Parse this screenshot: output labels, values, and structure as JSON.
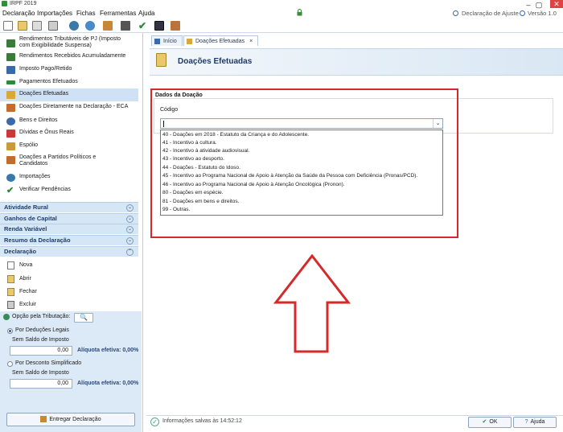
{
  "window": {
    "title": "IRPF 2019",
    "minimize": "–",
    "maximize": "▢",
    "close": "✕"
  },
  "menu": {
    "items": [
      "Declaração",
      "Importações",
      "Fichas",
      "Ferramentas",
      "Ajuda"
    ],
    "help_link": "Declaração de Ajuste",
    "version": "Versão 1.0"
  },
  "sidebar": {
    "items": [
      {
        "label": "Rendimentos Tributáveis de PJ (Imposto\ncom Exigibilidade Suspensa)",
        "icon": "money-icon",
        "color": "#3a7a3a"
      },
      {
        "label": "Rendimentos Recebidos Acumuladamente",
        "icon": "money-icon",
        "color": "#3a7a3a"
      },
      {
        "label": "Imposto Pago/Retido",
        "icon": "receipt-icon",
        "color": "#3a6aa8"
      },
      {
        "label": "Pagamentos Efetuados",
        "icon": "payment-icon",
        "color": "#2d8a3a"
      },
      {
        "label": "Doações Efetuadas",
        "icon": "donation-icon",
        "color": "#d8a93a"
      },
      {
        "label": "Doações Diretamente na Declaração - ECA",
        "icon": "eca-icon",
        "color": "#c86a2a"
      },
      {
        "label": "Bens e Direitos",
        "icon": "house-icon",
        "color": "#3a6aa8"
      },
      {
        "label": "Dívidas e Ônus Reais",
        "icon": "debt-icon",
        "color": "#c83a3a"
      },
      {
        "label": "Espólio",
        "icon": "estate-icon",
        "color": "#c89a3a"
      },
      {
        "label": "Doações a Partidos Políticos e\nCandidatos",
        "icon": "party-icon",
        "color": "#c86a2a"
      },
      {
        "label": "Importações",
        "icon": "import-icon",
        "color": "#3a7aa8"
      },
      {
        "label": "Verificar Pendências",
        "icon": "check-icon",
        "color": "#2d8a3a"
      }
    ],
    "groups": [
      "Atividade Rural",
      "Ganhos de Capital",
      "Renda Variável",
      "Resumo da Declaração",
      "Declaração"
    ],
    "declaracao_items": [
      "Nova",
      "Abrir",
      "Fechar",
      "Excluir"
    ]
  },
  "opcao": {
    "title": "Opção pela Tributação:",
    "search_icon": "🔍",
    "deducoes_label": "Por Deduções Legais",
    "deducoes_sub": "Sem Saldo de Imposto",
    "deducoes_value": "0,00",
    "deducoes_aliquota": "Alíquota efetiva: 0,00%",
    "simplificado_label": "Por Desconto Simplificado",
    "simplificado_sub": "Sem Saldo de Imposto",
    "simplificado_value": "0,00",
    "simplificado_aliquota": "Alíquota efetiva: 0,00%",
    "entregar": "Entregar Declaração"
  },
  "tabs": [
    {
      "label": "Início"
    },
    {
      "label": "Doações Efetuadas",
      "close": "×"
    }
  ],
  "page": {
    "title": "Doações Efetuadas"
  },
  "form": {
    "section": "Dados da Doação",
    "field_label": "Código",
    "value": "",
    "options": [
      "40 - Doações em 2018 - Estatuto da Criança e do Adolescente.",
      "41 - Incentivo à cultura.",
      "42 - Incentivo à atividade audiovisual.",
      "43 - Incentivo ao desporto.",
      "44 - Doações - Estatuto do Idoso.",
      "45 - Incentivo ao Programa Nacional de Apoio à Atenção da Saúde da Pessoa com Deficiência (Pronas/PCD).",
      "46 - Incentivo ao Programa Nacional de Apoio à Atenção Oncológica (Pronon).",
      "80 - Doações em espécie.",
      "81 - Doações em bens e direitos.",
      "99 - Outras."
    ]
  },
  "status": {
    "text": "Informações salvas às 14:52:12"
  },
  "buttons": {
    "ok": "OK",
    "ajuda": "Ajuda"
  },
  "colors": {
    "highlight": "#d42a2a",
    "accent": "#1d3a64"
  }
}
